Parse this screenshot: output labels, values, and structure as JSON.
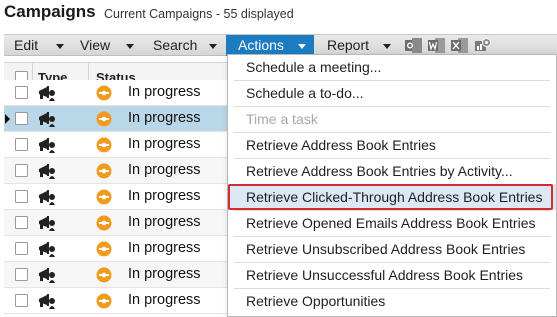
{
  "header": {
    "title": "Campaigns",
    "subtitle": "Current Campaigns - 55 displayed"
  },
  "toolbar": {
    "edit": "Edit",
    "view": "View",
    "search": "Search",
    "actions": "Actions",
    "report": "Report",
    "icons": [
      "outlook-icon",
      "word-icon",
      "excel-icon",
      "settings-chart-icon"
    ]
  },
  "grid": {
    "columns": {
      "type": "Type",
      "status": "Status"
    },
    "rows": [
      {
        "status": "In progress",
        "selected": false
      },
      {
        "status": "In progress",
        "selected": true
      },
      {
        "status": "In progress",
        "selected": false
      },
      {
        "status": "In progress",
        "selected": false
      },
      {
        "status": "In progress",
        "selected": false
      },
      {
        "status": "In progress",
        "selected": false
      },
      {
        "status": "In progress",
        "selected": false
      },
      {
        "status": "In progress",
        "selected": false
      },
      {
        "status": "In progress",
        "selected": false
      }
    ]
  },
  "menu": {
    "items": [
      {
        "label": "Schedule a meeting...",
        "disabled": false
      },
      {
        "label": "Schedule a to-do...",
        "disabled": false
      },
      {
        "label": "Time a task",
        "disabled": true
      },
      {
        "label": "Retrieve Address Book Entries",
        "disabled": false
      },
      {
        "label": "Retrieve Address Book Entries by Activity...",
        "disabled": false
      },
      {
        "label": "Retrieve Clicked-Through Address Book Entries",
        "disabled": false,
        "highlighted": true
      },
      {
        "label": "Retrieve Opened Emails Address Book Entries",
        "disabled": false
      },
      {
        "label": "Retrieve Unsubscribed Address Book Entries",
        "disabled": false
      },
      {
        "label": "Retrieve Unsuccessful Address Book Entries",
        "disabled": false
      },
      {
        "label": "Retrieve Opportunities",
        "disabled": false
      }
    ]
  },
  "colors": {
    "accent": "#1c7cc0",
    "selected_row": "#b9d7e8",
    "status_orange": "#f29a1f",
    "highlight_border": "#d62b2b"
  }
}
